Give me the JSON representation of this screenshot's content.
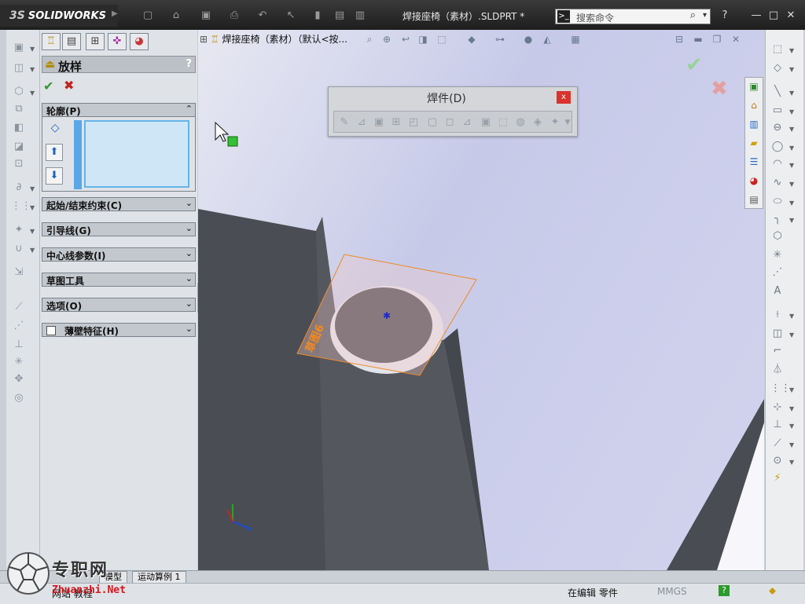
{
  "app": {
    "name": "SOLIDWORKS",
    "brand_mark": "3S",
    "document_title": "焊接座椅（素材）.SLDPRT *"
  },
  "search": {
    "placeholder": "搜索命令"
  },
  "window_controls": {
    "help": "?",
    "minimize": "—",
    "restore": "□",
    "close": "✕"
  },
  "property_manager": {
    "title": "放样",
    "help": "?",
    "sections": [
      {
        "label": "轮廓(P)",
        "state": "expanded"
      },
      {
        "label": "起始/结束约束(C)",
        "state": "collapsed"
      },
      {
        "label": "引导线(G)",
        "state": "collapsed"
      },
      {
        "label": "中心线参数(I)",
        "state": "collapsed"
      },
      {
        "label": "草图工具",
        "state": "collapsed"
      },
      {
        "label": "选项(O)",
        "state": "collapsed"
      },
      {
        "label": "薄壁特征(H)",
        "state": "collapsed",
        "checkbox": false
      }
    ]
  },
  "viewport": {
    "tree_header": "焊接座椅（素材）（默认<按..."
  },
  "weldments_toolbar": {
    "title": "焊件(D)",
    "close": "x"
  },
  "sketch_label": "草图6",
  "bottom_tabs": [
    "模型",
    "运动算例 1"
  ],
  "status_bar": {
    "left": "网站 教程",
    "editing": "在编辑 零件",
    "units": "MMGS",
    "help": "?"
  },
  "watermark": {
    "brand": "专职网",
    "url": "Zhuanzhi.Net"
  },
  "colors": {
    "accent_green": "#2c9a2c",
    "accent_red": "#c1221c",
    "sketch_orange": "#f08a24",
    "selection_blue": "#66b4ea"
  }
}
